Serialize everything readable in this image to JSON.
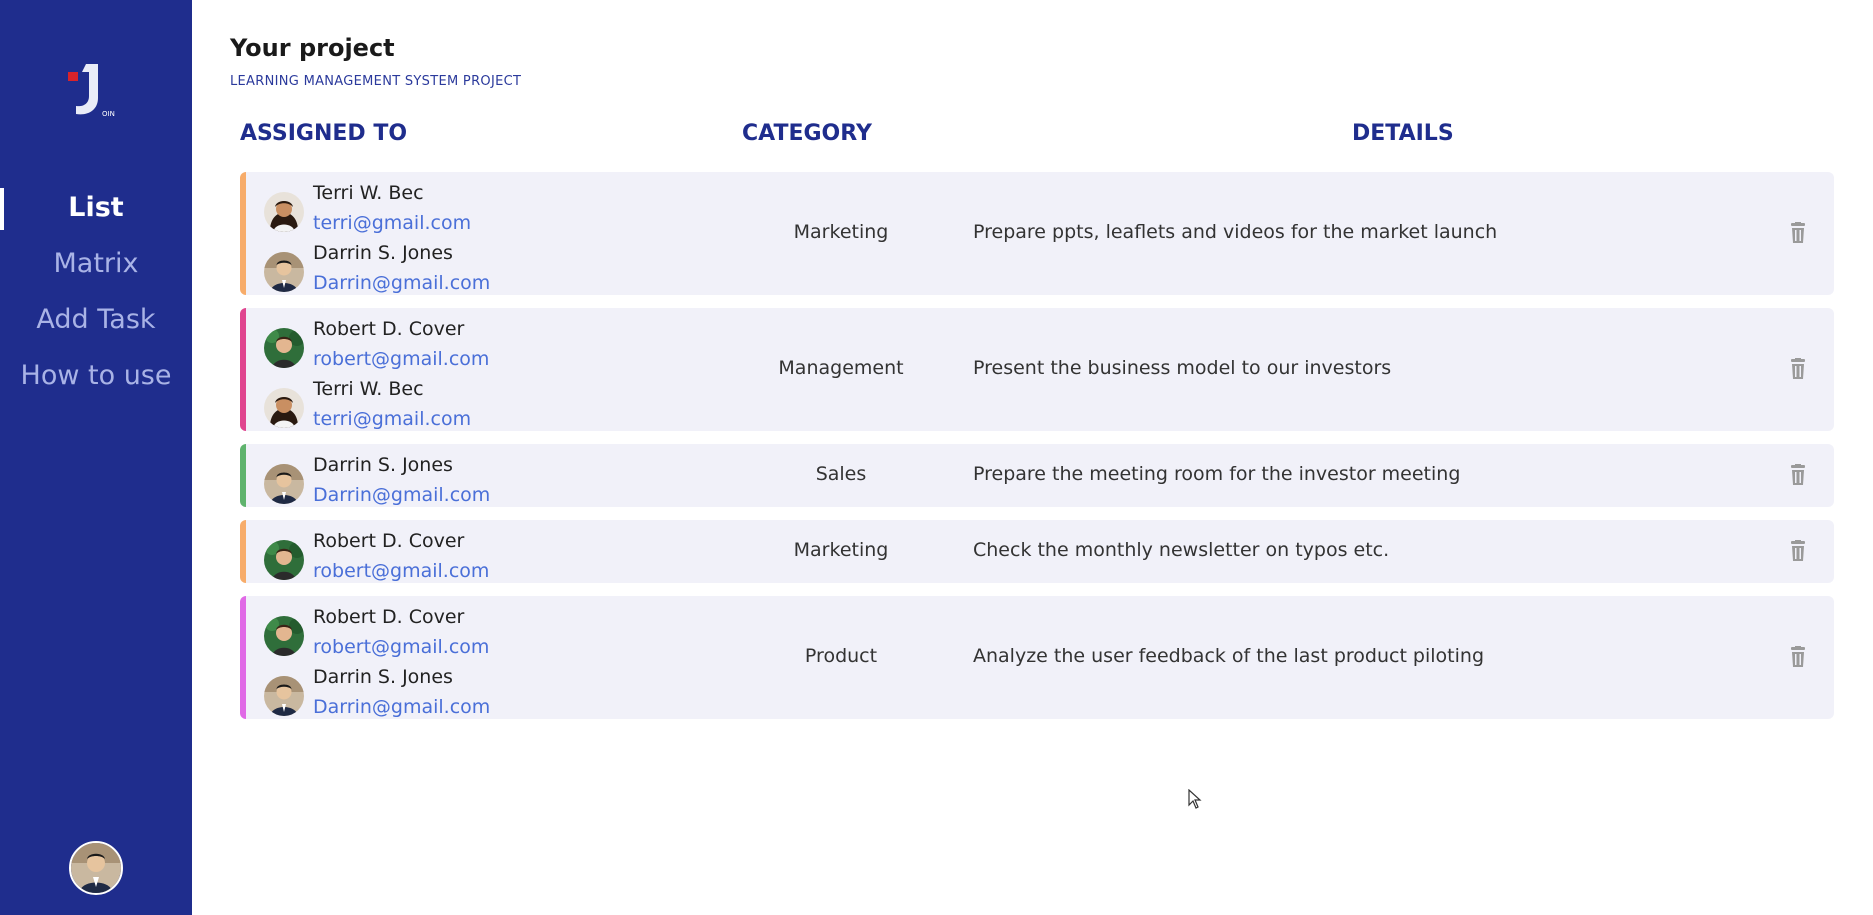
{
  "sidebar": {
    "logo_letters": "OIN",
    "nav": [
      {
        "label": "List",
        "active": true
      },
      {
        "label": "Matrix",
        "active": false
      },
      {
        "label": "Add Task",
        "active": false
      },
      {
        "label": "How to use",
        "active": false
      }
    ],
    "user_avatar_icon": "user-avatar"
  },
  "main": {
    "title": "Your project",
    "subtitle": "LEARNING MANAGEMENT SYSTEM PROJECT",
    "headers": {
      "assigned": "ASSIGNED TO",
      "category": "CATEGORY",
      "details": "DETAILS"
    }
  },
  "tasks": [
    {
      "color": "#f7ac6a",
      "assignees": [
        {
          "name": "Terri W. Bec",
          "email": "terri@gmail.com"
        },
        {
          "name": "Darrin S. Jones",
          "email": "Darrin@gmail.com"
        }
      ],
      "category": "Marketing",
      "details": "Prepare ppts, leaflets and videos for the market launch"
    },
    {
      "color": "#e0458f",
      "assignees": [
        {
          "name": "Robert D. Cover",
          "email": "robert@gmail.com"
        },
        {
          "name": "Terri W. Bec",
          "email": "terri@gmail.com"
        }
      ],
      "category": "Management",
      "details": "Present the business model to our investors"
    },
    {
      "color": "#5fb36d",
      "assignees": [
        {
          "name": "Darrin S. Jones",
          "email": "Darrin@gmail.com"
        }
      ],
      "category": "Sales",
      "details": "Prepare the meeting room for the investor meeting"
    },
    {
      "color": "#f7ac6a",
      "assignees": [
        {
          "name": "Robert D. Cover",
          "email": "robert@gmail.com"
        }
      ],
      "category": "Marketing",
      "details": "Check the monthly newsletter on typos etc."
    },
    {
      "color": "#e06ae6",
      "assignees": [
        {
          "name": "Robert D. Cover",
          "email": "robert@gmail.com"
        },
        {
          "name": "Darrin S. Jones",
          "email": "Darrin@gmail.com"
        }
      ],
      "category": "Product",
      "details": "Analyze the user feedback of the last product piloting"
    }
  ],
  "icons": {
    "delete": "trash-icon",
    "cursor": "mouse-cursor-icon"
  }
}
